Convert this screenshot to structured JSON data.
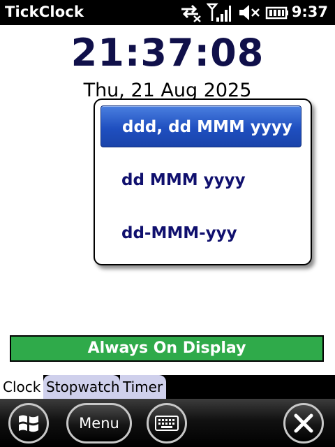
{
  "statusbar": {
    "app_title": "TickClock",
    "time": "9:37",
    "icons": [
      "data-connection-icon",
      "signal-strength-icon",
      "speaker-muted-icon",
      "battery-icon"
    ]
  },
  "clock": {
    "time": "21:37:08",
    "date": "Thu, 21 Aug 2025"
  },
  "date_format_dropdown": {
    "options": [
      "ddd, dd MMM yyyy",
      "dd MMM yyyy",
      "dd-MMM-yyy"
    ],
    "selected": "ddd, dd MMM yyyy"
  },
  "always_on_display": {
    "label": "Always On Display",
    "color": "#2faa4a"
  },
  "tabs": [
    {
      "label": "Clock",
      "active": true
    },
    {
      "label": "Stopwatch",
      "active": false
    },
    {
      "label": "Timer",
      "active": false
    }
  ],
  "softkeys": {
    "start_icon": "windows-flag-icon",
    "menu_label": "Menu",
    "keyboard_icon": "keyboard-icon",
    "close_icon": "close-icon"
  },
  "colors": {
    "clock_text": "#10104a",
    "option_text": "#10106e",
    "selection": "#1f4fc0",
    "inactive_tab": "#cfd0ec"
  }
}
